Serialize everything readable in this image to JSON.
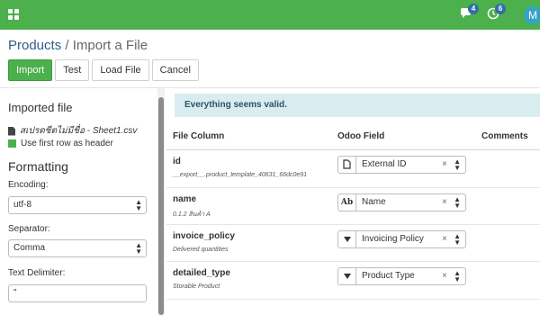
{
  "topbar": {
    "color": "#4cb04c",
    "chat_badge": "4",
    "activity_badge": "6",
    "avatar_initial": "M"
  },
  "breadcrumb": {
    "parent": "Products",
    "separator": "/",
    "current": "Import a File"
  },
  "toolbar": {
    "import_label": "Import",
    "test_label": "Test",
    "load_file_label": "Load File",
    "cancel_label": "Cancel"
  },
  "sidebar": {
    "imported_file_title": "Imported file",
    "file_name": "สเปรดชีตไม่มีชื่อ - Sheet1.csv",
    "first_row_header_label": "Use first row as header",
    "first_row_header_checked": true,
    "formatting_title": "Formatting",
    "encoding_label": "Encoding:",
    "encoding_value": "utf-8",
    "separator_label": "Separator:",
    "separator_value": "Comma",
    "text_delimiter_label": "Text Delimiter:",
    "text_delimiter_value": "\""
  },
  "main": {
    "alert_text": "Everything seems valid.",
    "columns": {
      "file_column": "File Column",
      "odoo_field": "Odoo Field",
      "comments": "Comments"
    },
    "rows": [
      {
        "name": "id",
        "sample": "__export__.product_template_40631_66dc0e91",
        "field": "External ID",
        "type_icon": "document-icon"
      },
      {
        "name": "name",
        "sample": "0.1.2 สินค้า A",
        "field": "Name",
        "type_icon": "text-ab-icon",
        "type_text": "Ab"
      },
      {
        "name": "invoice_policy",
        "sample": "Delivered quantities",
        "field": "Invoicing Policy",
        "type_icon": "dropdown-triangle-icon"
      },
      {
        "name": "detailed_type",
        "sample": "Storable Product",
        "field": "Product Type",
        "type_icon": "dropdown-triangle-icon"
      }
    ],
    "clear_glyph": "×"
  }
}
